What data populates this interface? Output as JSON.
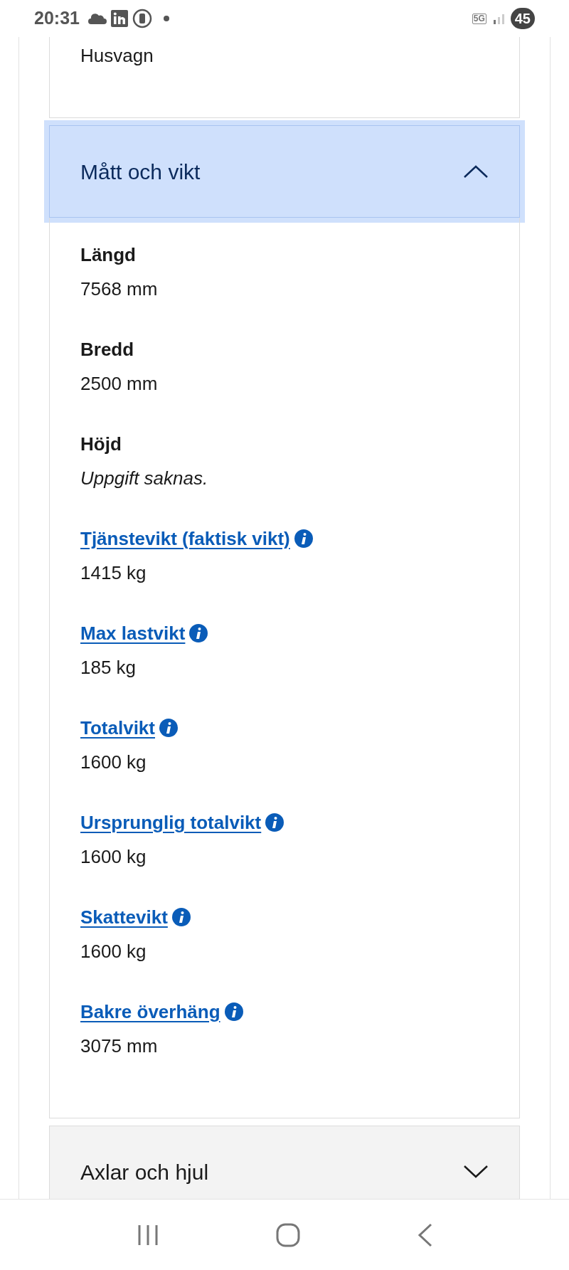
{
  "status_bar": {
    "time": "20:31",
    "network": "5G",
    "battery": "45"
  },
  "previous_section": {
    "value": "Husvagn"
  },
  "sections": [
    {
      "title": "Mått och vikt",
      "expanded": true,
      "fields": [
        {
          "kind": "plain",
          "label": "Längd",
          "value": "7568 mm",
          "missing": false
        },
        {
          "kind": "plain",
          "label": "Bredd",
          "value": "2500 mm",
          "missing": false
        },
        {
          "kind": "plain",
          "label": "Höjd",
          "value": "Uppgift saknas.",
          "missing": true
        },
        {
          "kind": "link",
          "label": "Tjänstevikt (faktisk vikt)",
          "value": "1415 kg",
          "missing": false
        },
        {
          "kind": "link",
          "label": "Max lastvikt",
          "value": "185 kg",
          "missing": false
        },
        {
          "kind": "link",
          "label": "Totalvikt",
          "value": "1600 kg",
          "missing": false
        },
        {
          "kind": "link",
          "label": "Ursprunglig totalvikt",
          "value": "1600 kg",
          "missing": false
        },
        {
          "kind": "link",
          "label": "Skattevikt",
          "value": "1600 kg",
          "missing": false
        },
        {
          "kind": "link",
          "label": "Bakre överhäng",
          "value": "3075 mm",
          "missing": false
        }
      ]
    },
    {
      "title": "Axlar och hjul",
      "expanded": false
    }
  ]
}
